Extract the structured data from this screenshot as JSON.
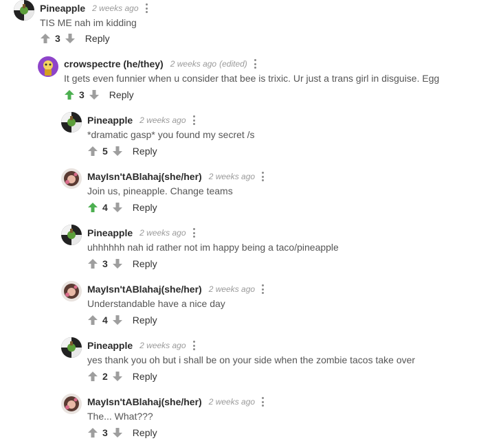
{
  "colors": {
    "upvoted": "#4caf50",
    "vote_gray": "#9e9e9e"
  },
  "comments": [
    {
      "author": "Pineapple",
      "time": "2 weeks ago",
      "edited": "",
      "text": "TIS ME nah im kidding",
      "votes": "3",
      "upvoted": false,
      "reply": "Reply",
      "avatar": "pineapple-avatar"
    },
    {
      "author": "crowspectre (he/they)",
      "time": "2 weeks ago",
      "edited": "(edited)",
      "text": "It gets even funnier when u consider that bee is trixic. Ur just a trans girl in disguise. Egg",
      "votes": "3",
      "upvoted": true,
      "reply": "Reply",
      "avatar": "crow-avatar"
    },
    {
      "author": "Pineapple",
      "time": "2 weeks ago",
      "edited": "",
      "text": "*dramatic gasp* you found my secret /s",
      "votes": "5",
      "upvoted": false,
      "reply": "Reply",
      "avatar": "pineapple-avatar"
    },
    {
      "author": "MayIsn'tABlahaj(she/her)",
      "time": "2 weeks ago",
      "edited": "",
      "text": "Join us, pineapple. Change teams",
      "votes": "4",
      "upvoted": true,
      "reply": "Reply",
      "avatar": "may-avatar"
    },
    {
      "author": "Pineapple",
      "time": "2 weeks ago",
      "edited": "",
      "text": "uhhhhhh nah id rather not im happy being a taco/pineapple",
      "votes": "3",
      "upvoted": false,
      "reply": "Reply",
      "avatar": "pineapple-avatar"
    },
    {
      "author": "MayIsn'tABlahaj(she/her)",
      "time": "2 weeks ago",
      "edited": "",
      "text": "Understandable have a nice day",
      "votes": "4",
      "upvoted": false,
      "reply": "Reply",
      "avatar": "may-avatar"
    },
    {
      "author": "Pineapple",
      "time": "2 weeks ago",
      "edited": "",
      "text": "yes thank you oh but i shall be on your side when the zombie tacos take over",
      "votes": "2",
      "upvoted": false,
      "reply": "Reply",
      "avatar": "pineapple-avatar"
    },
    {
      "author": "MayIsn'tABlahaj(she/her)",
      "time": "2 weeks ago",
      "edited": "",
      "text": "The... What???",
      "votes": "3",
      "upvoted": false,
      "reply": "Reply",
      "avatar": "may-avatar"
    }
  ]
}
